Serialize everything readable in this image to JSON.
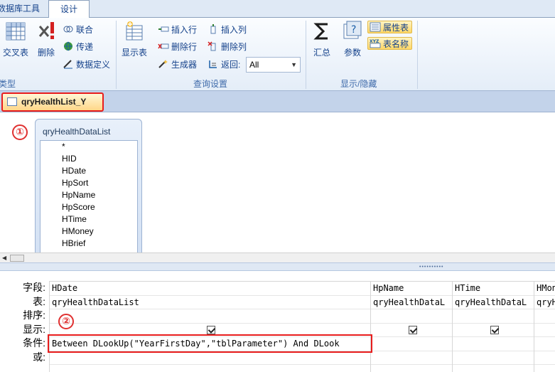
{
  "ribbon": {
    "tabs": [
      "数据库工具",
      "设计"
    ],
    "groups": {
      "type": {
        "label": "类型",
        "crosstab": "交叉表",
        "delete": "删除",
        "union": "联合",
        "passthrough": "传递",
        "datadef": "数据定义"
      },
      "setup": {
        "label": "查询设置",
        "show_table": "显示表",
        "insert_row": "插入行",
        "delete_row": "删除行",
        "builder": "生成器",
        "insert_col": "插入列",
        "delete_col": "删除列",
        "return_label": "返回:",
        "return_value": "All"
      },
      "showhide": {
        "label": "显示/隐藏",
        "totals": "汇总",
        "params": "参数",
        "property_sheet": "属性表",
        "table_names": "表名称"
      }
    }
  },
  "document_tab": "qryHealthList_Y",
  "markers": {
    "one": "①",
    "two": "②"
  },
  "field_list": {
    "title": "qryHealthDataList",
    "fields": [
      "*",
      "HID",
      "HDate",
      "HpSort",
      "HpName",
      "HpScore",
      "HTime",
      "HMoney",
      "HBrief"
    ]
  },
  "grid": {
    "row_labels": [
      "字段:",
      "表:",
      "排序:",
      "显示:",
      "条件:",
      "或:"
    ],
    "columns": [
      {
        "field": "HDate",
        "table": "qryHealthDataList",
        "sort": "",
        "show": true,
        "criteria": "Between DLookUp(\"YearFirstDay\",\"tblParameter\") And DLook",
        "or": ""
      },
      {
        "field": "HpName",
        "table": "qryHealthDataL",
        "sort": "",
        "show": true,
        "criteria": "",
        "or": ""
      },
      {
        "field": "HTime",
        "table": "qryHealthDataL",
        "sort": "",
        "show": true,
        "criteria": "",
        "or": ""
      },
      {
        "field": "HMon",
        "table": "qryH",
        "sort": "",
        "show": false,
        "criteria": "",
        "or": ""
      }
    ]
  },
  "colors": {
    "highlight_red": "#e81d1d",
    "ribbon_blue": "#15428b"
  }
}
